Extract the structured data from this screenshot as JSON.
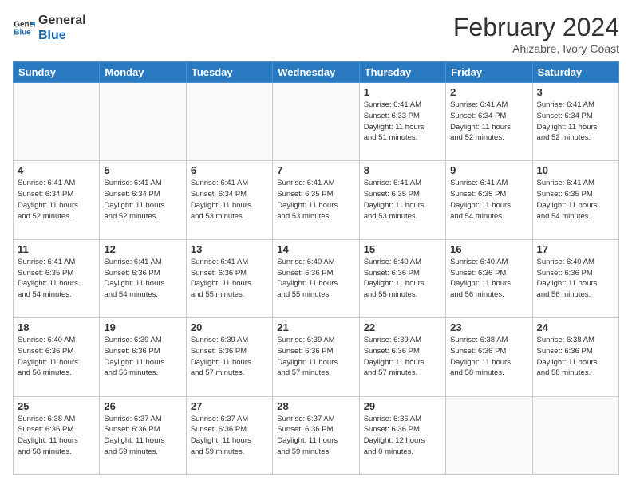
{
  "header": {
    "logo_line1": "General",
    "logo_line2": "Blue",
    "month_year": "February 2024",
    "location": "Ahizabre, Ivory Coast"
  },
  "weekdays": [
    "Sunday",
    "Monday",
    "Tuesday",
    "Wednesday",
    "Thursday",
    "Friday",
    "Saturday"
  ],
  "weeks": [
    [
      {
        "day": "",
        "info": ""
      },
      {
        "day": "",
        "info": ""
      },
      {
        "day": "",
        "info": ""
      },
      {
        "day": "",
        "info": ""
      },
      {
        "day": "1",
        "info": "Sunrise: 6:41 AM\nSunset: 6:33 PM\nDaylight: 11 hours\nand 51 minutes."
      },
      {
        "day": "2",
        "info": "Sunrise: 6:41 AM\nSunset: 6:34 PM\nDaylight: 11 hours\nand 52 minutes."
      },
      {
        "day": "3",
        "info": "Sunrise: 6:41 AM\nSunset: 6:34 PM\nDaylight: 11 hours\nand 52 minutes."
      }
    ],
    [
      {
        "day": "4",
        "info": "Sunrise: 6:41 AM\nSunset: 6:34 PM\nDaylight: 11 hours\nand 52 minutes."
      },
      {
        "day": "5",
        "info": "Sunrise: 6:41 AM\nSunset: 6:34 PM\nDaylight: 11 hours\nand 52 minutes."
      },
      {
        "day": "6",
        "info": "Sunrise: 6:41 AM\nSunset: 6:34 PM\nDaylight: 11 hours\nand 53 minutes."
      },
      {
        "day": "7",
        "info": "Sunrise: 6:41 AM\nSunset: 6:35 PM\nDaylight: 11 hours\nand 53 minutes."
      },
      {
        "day": "8",
        "info": "Sunrise: 6:41 AM\nSunset: 6:35 PM\nDaylight: 11 hours\nand 53 minutes."
      },
      {
        "day": "9",
        "info": "Sunrise: 6:41 AM\nSunset: 6:35 PM\nDaylight: 11 hours\nand 54 minutes."
      },
      {
        "day": "10",
        "info": "Sunrise: 6:41 AM\nSunset: 6:35 PM\nDaylight: 11 hours\nand 54 minutes."
      }
    ],
    [
      {
        "day": "11",
        "info": "Sunrise: 6:41 AM\nSunset: 6:35 PM\nDaylight: 11 hours\nand 54 minutes."
      },
      {
        "day": "12",
        "info": "Sunrise: 6:41 AM\nSunset: 6:36 PM\nDaylight: 11 hours\nand 54 minutes."
      },
      {
        "day": "13",
        "info": "Sunrise: 6:41 AM\nSunset: 6:36 PM\nDaylight: 11 hours\nand 55 minutes."
      },
      {
        "day": "14",
        "info": "Sunrise: 6:40 AM\nSunset: 6:36 PM\nDaylight: 11 hours\nand 55 minutes."
      },
      {
        "day": "15",
        "info": "Sunrise: 6:40 AM\nSunset: 6:36 PM\nDaylight: 11 hours\nand 55 minutes."
      },
      {
        "day": "16",
        "info": "Sunrise: 6:40 AM\nSunset: 6:36 PM\nDaylight: 11 hours\nand 56 minutes."
      },
      {
        "day": "17",
        "info": "Sunrise: 6:40 AM\nSunset: 6:36 PM\nDaylight: 11 hours\nand 56 minutes."
      }
    ],
    [
      {
        "day": "18",
        "info": "Sunrise: 6:40 AM\nSunset: 6:36 PM\nDaylight: 11 hours\nand 56 minutes."
      },
      {
        "day": "19",
        "info": "Sunrise: 6:39 AM\nSunset: 6:36 PM\nDaylight: 11 hours\nand 56 minutes."
      },
      {
        "day": "20",
        "info": "Sunrise: 6:39 AM\nSunset: 6:36 PM\nDaylight: 11 hours\nand 57 minutes."
      },
      {
        "day": "21",
        "info": "Sunrise: 6:39 AM\nSunset: 6:36 PM\nDaylight: 11 hours\nand 57 minutes."
      },
      {
        "day": "22",
        "info": "Sunrise: 6:39 AM\nSunset: 6:36 PM\nDaylight: 11 hours\nand 57 minutes."
      },
      {
        "day": "23",
        "info": "Sunrise: 6:38 AM\nSunset: 6:36 PM\nDaylight: 11 hours\nand 58 minutes."
      },
      {
        "day": "24",
        "info": "Sunrise: 6:38 AM\nSunset: 6:36 PM\nDaylight: 11 hours\nand 58 minutes."
      }
    ],
    [
      {
        "day": "25",
        "info": "Sunrise: 6:38 AM\nSunset: 6:36 PM\nDaylight: 11 hours\nand 58 minutes."
      },
      {
        "day": "26",
        "info": "Sunrise: 6:37 AM\nSunset: 6:36 PM\nDaylight: 11 hours\nand 59 minutes."
      },
      {
        "day": "27",
        "info": "Sunrise: 6:37 AM\nSunset: 6:36 PM\nDaylight: 11 hours\nand 59 minutes."
      },
      {
        "day": "28",
        "info": "Sunrise: 6:37 AM\nSunset: 6:36 PM\nDaylight: 11 hours\nand 59 minutes."
      },
      {
        "day": "29",
        "info": "Sunrise: 6:36 AM\nSunset: 6:36 PM\nDaylight: 12 hours\nand 0 minutes."
      },
      {
        "day": "",
        "info": ""
      },
      {
        "day": "",
        "info": ""
      }
    ]
  ]
}
